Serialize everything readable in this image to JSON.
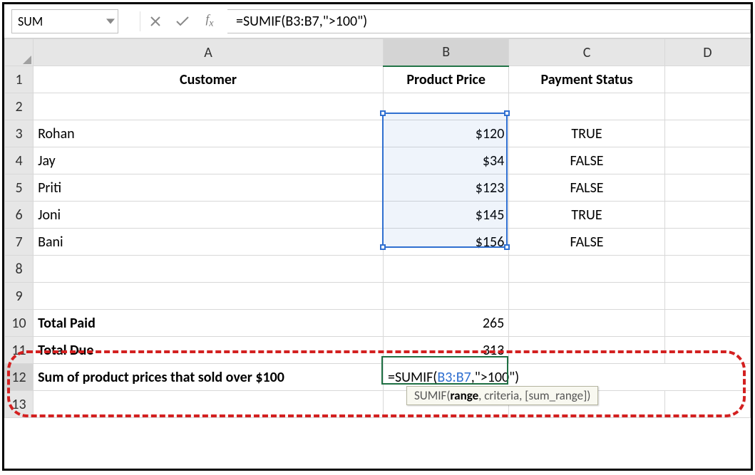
{
  "namebox": {
    "value": "SUM"
  },
  "formula_bar": {
    "value": "=SUMIF(B3:B7,\">100\")"
  },
  "columns": [
    "A",
    "B",
    "C",
    "D"
  ],
  "row_numbers": [
    "1",
    "2",
    "3",
    "4",
    "5",
    "6",
    "7",
    "8",
    "9",
    "10",
    "11",
    "12",
    "13"
  ],
  "headers": {
    "A": "Customer",
    "B": "Product Price",
    "C": "Payment Status"
  },
  "rows": [
    {
      "customer": "Rohan",
      "price": "$120",
      "status": "TRUE"
    },
    {
      "customer": "Jay",
      "price": "$34",
      "status": "FALSE"
    },
    {
      "customer": "Priti",
      "price": "$123",
      "status": "FALSE"
    },
    {
      "customer": "Joni",
      "price": "$145",
      "status": "TRUE"
    },
    {
      "customer": "Bani",
      "price": "$156",
      "status": "FALSE"
    }
  ],
  "totals": {
    "paid_label": "Total Paid",
    "paid_value": "265",
    "due_label": "Total Due",
    "due_value": "313",
    "over100_label": "Sum of product prices that sold over $100"
  },
  "editing": {
    "prefix": "=SUMIF(",
    "range": "B3:B7",
    "suffix": ",\">100\")"
  },
  "tooltip": {
    "fn": "SUMIF",
    "arg1_bold": "range",
    "rest": ", criteria, [sum_range])"
  }
}
